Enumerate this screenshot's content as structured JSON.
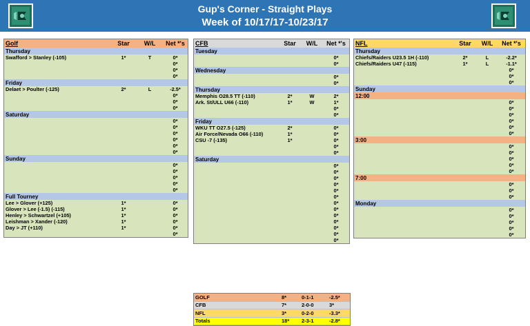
{
  "header": {
    "title": "Gup's Corner - Straight Plays",
    "subtitle": "Week of 10/17/17-10/23/17"
  },
  "columns": {
    "star": "Star",
    "wl": "W/L",
    "net": "Net *'s"
  },
  "golf": {
    "label": "Golf",
    "sections": [
      {
        "day": "Thursday",
        "rows": [
          {
            "name": "Swafford > Stanley (-105)",
            "star": "1*",
            "wl": "T",
            "net": "0*"
          },
          {
            "name": "",
            "star": "",
            "wl": "",
            "net": "0*"
          },
          {
            "name": "",
            "star": "",
            "wl": "",
            "net": "0*"
          },
          {
            "name": "",
            "star": "",
            "wl": "",
            "net": "0*"
          }
        ]
      },
      {
        "day": "Friday",
        "rows": [
          {
            "name": "Delaet > Poulter (-125)",
            "star": "2*",
            "wl": "L",
            "net": "-2.5*"
          },
          {
            "name": "",
            "star": "",
            "wl": "",
            "net": "0*"
          },
          {
            "name": "",
            "star": "",
            "wl": "",
            "net": "0*"
          },
          {
            "name": "",
            "star": "",
            "wl": "",
            "net": "0*"
          }
        ]
      },
      {
        "day": "Saturday",
        "rows": [
          {
            "name": "",
            "star": "",
            "wl": "",
            "net": "0*"
          },
          {
            "name": "",
            "star": "",
            "wl": "",
            "net": "0*"
          },
          {
            "name": "",
            "star": "",
            "wl": "",
            "net": "0*"
          },
          {
            "name": "",
            "star": "",
            "wl": "",
            "net": "0*"
          },
          {
            "name": "",
            "star": "",
            "wl": "",
            "net": "0*"
          },
          {
            "name": "",
            "star": "",
            "wl": "",
            "net": "0*"
          }
        ]
      },
      {
        "day": "Sunday",
        "rows": [
          {
            "name": "",
            "star": "",
            "wl": "",
            "net": "0*"
          },
          {
            "name": "",
            "star": "",
            "wl": "",
            "net": "0*"
          },
          {
            "name": "",
            "star": "",
            "wl": "",
            "net": "0*"
          },
          {
            "name": "",
            "star": "",
            "wl": "",
            "net": "0*"
          },
          {
            "name": "",
            "star": "",
            "wl": "",
            "net": "0*"
          }
        ]
      },
      {
        "day": "Full Tourney",
        "rows": [
          {
            "name": "Lee > Glover (+125)",
            "star": "1*",
            "wl": "",
            "net": "0*"
          },
          {
            "name": "Glover > Lee (-1.5) (-115)",
            "star": "1*",
            "wl": "",
            "net": "0*"
          },
          {
            "name": "Henley > Schwartzel (+105)",
            "star": "1*",
            "wl": "",
            "net": "0*"
          },
          {
            "name": "Leishman > Xander (-120)",
            "star": "1*",
            "wl": "",
            "net": "0*"
          },
          {
            "name": "Day > JT (+110)",
            "star": "1*",
            "wl": "",
            "net": "0*"
          },
          {
            "name": "",
            "star": "",
            "wl": "",
            "net": "0*"
          }
        ]
      }
    ]
  },
  "cfb": {
    "label": "CFB",
    "sections": [
      {
        "day": "Tuesday",
        "rows": [
          {
            "name": "",
            "star": "",
            "wl": "",
            "net": "0*"
          },
          {
            "name": "",
            "star": "",
            "wl": "",
            "net": "0*"
          }
        ]
      },
      {
        "day": "Wednesday",
        "rows": [
          {
            "name": "",
            "star": "",
            "wl": "",
            "net": "0*"
          },
          {
            "name": "",
            "star": "",
            "wl": "",
            "net": "0*"
          }
        ]
      },
      {
        "day": "Thursday",
        "rows": [
          {
            "name": "Memphis O28.5 TT (-110)",
            "star": "2*",
            "wl": "W",
            "net": "2*"
          },
          {
            "name": "Ark. St/ULL U66 (-110)",
            "star": "1*",
            "wl": "W",
            "net": "1*"
          },
          {
            "name": "",
            "star": "",
            "wl": "",
            "net": "0*"
          },
          {
            "name": "",
            "star": "",
            "wl": "",
            "net": "0*"
          }
        ]
      },
      {
        "day": "Friday",
        "rows": [
          {
            "name": "WKU TT O27.5 (-125)",
            "star": "2*",
            "wl": "",
            "net": "0*"
          },
          {
            "name": "Air Force/Nevada O66 (-110)",
            "star": "1*",
            "wl": "",
            "net": "0*"
          },
          {
            "name": "CSU -7 (-135)",
            "star": "1*",
            "wl": "",
            "net": "0*"
          },
          {
            "name": "",
            "star": "",
            "wl": "",
            "net": "0*"
          },
          {
            "name": "",
            "star": "",
            "wl": "",
            "net": "0*"
          }
        ]
      },
      {
        "day": "Saturday",
        "rows": [
          {
            "name": "",
            "star": "",
            "wl": "",
            "net": "0*"
          },
          {
            "name": "",
            "star": "",
            "wl": "",
            "net": "0*"
          },
          {
            "name": "",
            "star": "",
            "wl": "",
            "net": "0*"
          },
          {
            "name": "",
            "star": "",
            "wl": "",
            "net": "0*"
          },
          {
            "name": "",
            "star": "",
            "wl": "",
            "net": "0*"
          },
          {
            "name": "",
            "star": "",
            "wl": "",
            "net": "0*"
          },
          {
            "name": "",
            "star": "",
            "wl": "",
            "net": "0*"
          },
          {
            "name": "",
            "star": "",
            "wl": "",
            "net": "0*"
          },
          {
            "name": "",
            "star": "",
            "wl": "",
            "net": "0*"
          },
          {
            "name": "",
            "star": "",
            "wl": "",
            "net": "0*"
          },
          {
            "name": "",
            "star": "",
            "wl": "",
            "net": "0*"
          },
          {
            "name": "",
            "star": "",
            "wl": "",
            "net": "0*"
          },
          {
            "name": "",
            "star": "",
            "wl": "",
            "net": "0*"
          }
        ]
      }
    ]
  },
  "nfl": {
    "label": "NFL",
    "thursday": {
      "day": "Thursday",
      "rows": [
        {
          "name": "Chiefs/Raiders U23.5 1H (-110)",
          "star": "2*",
          "wl": "L",
          "net": "-2.2*"
        },
        {
          "name": "Chiefs/Raiders U47 (-115)",
          "star": "1*",
          "wl": "L",
          "net": "-1.1*"
        },
        {
          "name": "",
          "star": "",
          "wl": "",
          "net": "0*"
        },
        {
          "name": "",
          "star": "",
          "wl": "",
          "net": "0*"
        },
        {
          "name": "",
          "star": "",
          "wl": "",
          "net": "0*"
        }
      ]
    },
    "sunday": {
      "day": "Sunday",
      "slots": [
        {
          "time": "12:00",
          "rows": [
            "0*",
            "0*",
            "0*",
            "0*",
            "0*",
            "0*"
          ]
        },
        {
          "time": "3:00",
          "rows": [
            "0*",
            "0*",
            "0*",
            "0*",
            "0*"
          ]
        },
        {
          "time": "7:00",
          "rows": [
            "0*",
            "0*",
            "0*"
          ]
        }
      ]
    },
    "monday": {
      "day": "Monday",
      "rows": [
        "0*",
        "0*",
        "0*",
        "0*",
        "0*"
      ]
    }
  },
  "totals": [
    {
      "label": "GOLF",
      "star": "8*",
      "record": "0-1-1",
      "net": "-2.5*",
      "color": "#f4b183"
    },
    {
      "label": "CFB",
      "star": "7*",
      "record": "2-0-0",
      "net": "3*",
      "color": "#d9d9d9"
    },
    {
      "label": "NFL",
      "star": "3*",
      "record": "0-2-0",
      "net": "-3.3*",
      "color": "#ffd966"
    },
    {
      "label": "Totals",
      "star": "18*",
      "record": "2-3-1",
      "net": "-2.8*",
      "color": "#ffff00"
    }
  ]
}
